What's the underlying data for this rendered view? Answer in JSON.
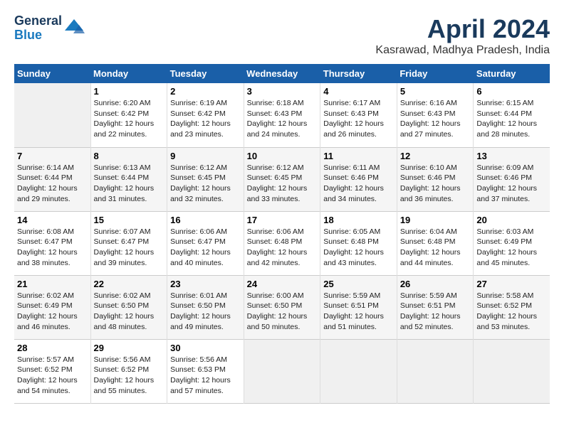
{
  "header": {
    "logo_line1": "General",
    "logo_line2": "Blue",
    "month": "April 2024",
    "location": "Kasrawad, Madhya Pradesh, India"
  },
  "days_of_week": [
    "Sunday",
    "Monday",
    "Tuesday",
    "Wednesday",
    "Thursday",
    "Friday",
    "Saturday"
  ],
  "weeks": [
    [
      {
        "day": "",
        "empty": true
      },
      {
        "day": "1",
        "sunrise": "6:20 AM",
        "sunset": "6:42 PM",
        "daylight": "12 hours and 22 minutes."
      },
      {
        "day": "2",
        "sunrise": "6:19 AM",
        "sunset": "6:42 PM",
        "daylight": "12 hours and 23 minutes."
      },
      {
        "day": "3",
        "sunrise": "6:18 AM",
        "sunset": "6:43 PM",
        "daylight": "12 hours and 24 minutes."
      },
      {
        "day": "4",
        "sunrise": "6:17 AM",
        "sunset": "6:43 PM",
        "daylight": "12 hours and 26 minutes."
      },
      {
        "day": "5",
        "sunrise": "6:16 AM",
        "sunset": "6:43 PM",
        "daylight": "12 hours and 27 minutes."
      },
      {
        "day": "6",
        "sunrise": "6:15 AM",
        "sunset": "6:44 PM",
        "daylight": "12 hours and 28 minutes."
      }
    ],
    [
      {
        "day": "7",
        "sunrise": "6:14 AM",
        "sunset": "6:44 PM",
        "daylight": "12 hours and 29 minutes."
      },
      {
        "day": "8",
        "sunrise": "6:13 AM",
        "sunset": "6:44 PM",
        "daylight": "12 hours and 31 minutes."
      },
      {
        "day": "9",
        "sunrise": "6:12 AM",
        "sunset": "6:45 PM",
        "daylight": "12 hours and 32 minutes."
      },
      {
        "day": "10",
        "sunrise": "6:12 AM",
        "sunset": "6:45 PM",
        "daylight": "12 hours and 33 minutes."
      },
      {
        "day": "11",
        "sunrise": "6:11 AM",
        "sunset": "6:46 PM",
        "daylight": "12 hours and 34 minutes."
      },
      {
        "day": "12",
        "sunrise": "6:10 AM",
        "sunset": "6:46 PM",
        "daylight": "12 hours and 36 minutes."
      },
      {
        "day": "13",
        "sunrise": "6:09 AM",
        "sunset": "6:46 PM",
        "daylight": "12 hours and 37 minutes."
      }
    ],
    [
      {
        "day": "14",
        "sunrise": "6:08 AM",
        "sunset": "6:47 PM",
        "daylight": "12 hours and 38 minutes."
      },
      {
        "day": "15",
        "sunrise": "6:07 AM",
        "sunset": "6:47 PM",
        "daylight": "12 hours and 39 minutes."
      },
      {
        "day": "16",
        "sunrise": "6:06 AM",
        "sunset": "6:47 PM",
        "daylight": "12 hours and 40 minutes."
      },
      {
        "day": "17",
        "sunrise": "6:06 AM",
        "sunset": "6:48 PM",
        "daylight": "12 hours and 42 minutes."
      },
      {
        "day": "18",
        "sunrise": "6:05 AM",
        "sunset": "6:48 PM",
        "daylight": "12 hours and 43 minutes."
      },
      {
        "day": "19",
        "sunrise": "6:04 AM",
        "sunset": "6:48 PM",
        "daylight": "12 hours and 44 minutes."
      },
      {
        "day": "20",
        "sunrise": "6:03 AM",
        "sunset": "6:49 PM",
        "daylight": "12 hours and 45 minutes."
      }
    ],
    [
      {
        "day": "21",
        "sunrise": "6:02 AM",
        "sunset": "6:49 PM",
        "daylight": "12 hours and 46 minutes."
      },
      {
        "day": "22",
        "sunrise": "6:02 AM",
        "sunset": "6:50 PM",
        "daylight": "12 hours and 48 minutes."
      },
      {
        "day": "23",
        "sunrise": "6:01 AM",
        "sunset": "6:50 PM",
        "daylight": "12 hours and 49 minutes."
      },
      {
        "day": "24",
        "sunrise": "6:00 AM",
        "sunset": "6:50 PM",
        "daylight": "12 hours and 50 minutes."
      },
      {
        "day": "25",
        "sunrise": "5:59 AM",
        "sunset": "6:51 PM",
        "daylight": "12 hours and 51 minutes."
      },
      {
        "day": "26",
        "sunrise": "5:59 AM",
        "sunset": "6:51 PM",
        "daylight": "12 hours and 52 minutes."
      },
      {
        "day": "27",
        "sunrise": "5:58 AM",
        "sunset": "6:52 PM",
        "daylight": "12 hours and 53 minutes."
      }
    ],
    [
      {
        "day": "28",
        "sunrise": "5:57 AM",
        "sunset": "6:52 PM",
        "daylight": "12 hours and 54 minutes."
      },
      {
        "day": "29",
        "sunrise": "5:56 AM",
        "sunset": "6:52 PM",
        "daylight": "12 hours and 55 minutes."
      },
      {
        "day": "30",
        "sunrise": "5:56 AM",
        "sunset": "6:53 PM",
        "daylight": "12 hours and 57 minutes."
      },
      {
        "day": "",
        "empty": true
      },
      {
        "day": "",
        "empty": true
      },
      {
        "day": "",
        "empty": true
      },
      {
        "day": "",
        "empty": true
      }
    ]
  ]
}
